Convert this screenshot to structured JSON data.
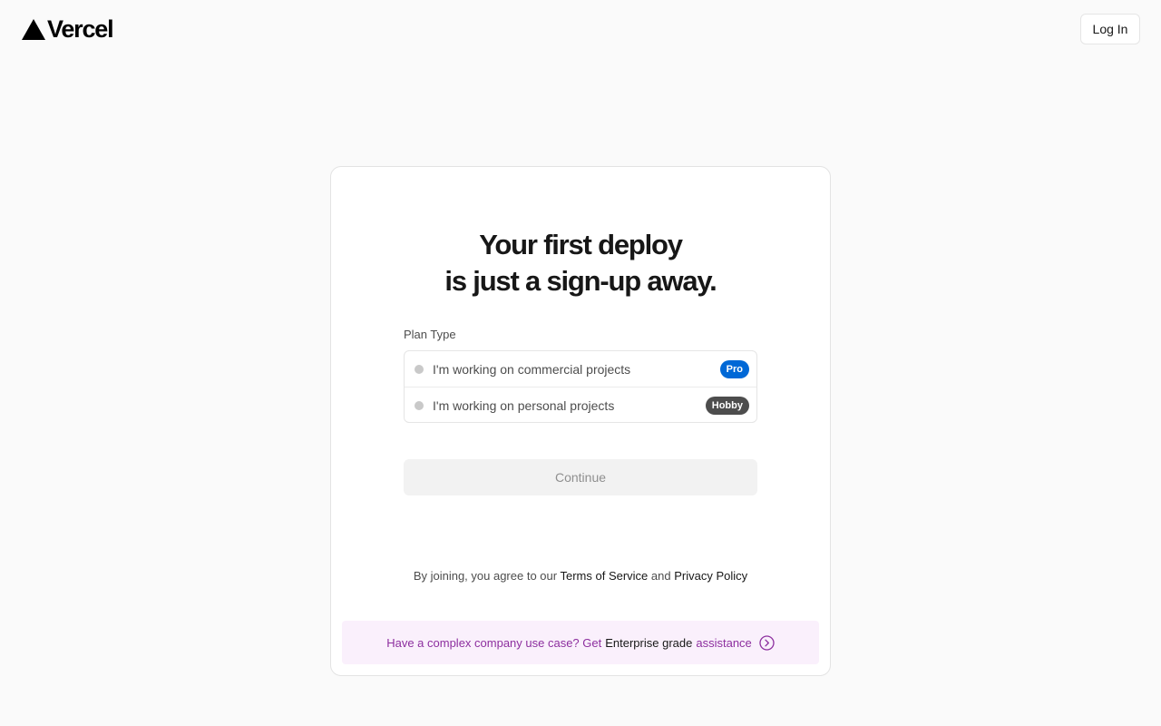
{
  "brand": {
    "name": "Vercel"
  },
  "header": {
    "login_label": "Log In"
  },
  "card": {
    "headline_line1": "Your first deploy",
    "headline_line2": "is just a sign-up away.",
    "plan_label": "Plan Type",
    "plans": [
      {
        "label": "I'm working on commercial projects",
        "badge": "Pro",
        "badge_color": "#0068d6"
      },
      {
        "label": "I'm working on personal projects",
        "badge": "Hobby",
        "badge_color": "#4d4d4d"
      }
    ],
    "continue_label": "Continue",
    "legal": {
      "prefix": "By joining, you agree to our",
      "terms": "Terms of Service",
      "and": "and",
      "privacy": "Privacy Policy"
    },
    "enterprise": {
      "prefix": "Have a complex company use case? Get",
      "strong": "Enterprise grade",
      "suffix": "assistance"
    }
  },
  "colors": {
    "accent_purple": "#8d2f9f",
    "pro_blue": "#0068d6"
  }
}
